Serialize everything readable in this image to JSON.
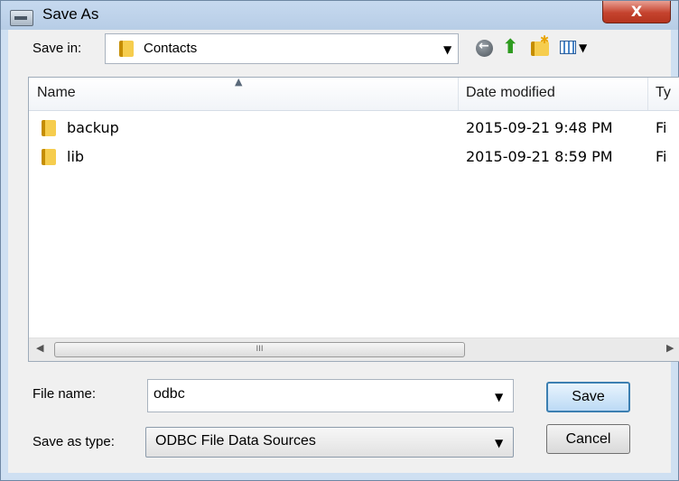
{
  "window": {
    "title": "Save As",
    "close_label": "X"
  },
  "save_in": {
    "label": "Save in:",
    "value": "Contacts"
  },
  "toolbar_icons": [
    "back-icon",
    "up-one-level-icon",
    "new-folder-icon",
    "views-menu-icon"
  ],
  "file_list": {
    "columns": [
      "Name",
      "Date modified",
      "Ty"
    ],
    "rows": [
      {
        "name": "backup",
        "date": "2015-09-21 9:48 PM",
        "type": "Fi"
      },
      {
        "name": "lib",
        "date": "2015-09-21 8:59 PM",
        "type": "Fi"
      }
    ],
    "scroll_grip": "III"
  },
  "file_name": {
    "label": "File name:",
    "value": "odbc"
  },
  "save_as_type": {
    "label": "Save as type:",
    "value": "ODBC File Data Sources"
  },
  "buttons": {
    "save": "Save",
    "cancel": "Cancel"
  },
  "colors": {
    "titlebar": "#c6d9ef",
    "close_button": "#c5432e",
    "client_bg": "#f0f0f0",
    "default_button_border": "#3c7fb1"
  }
}
